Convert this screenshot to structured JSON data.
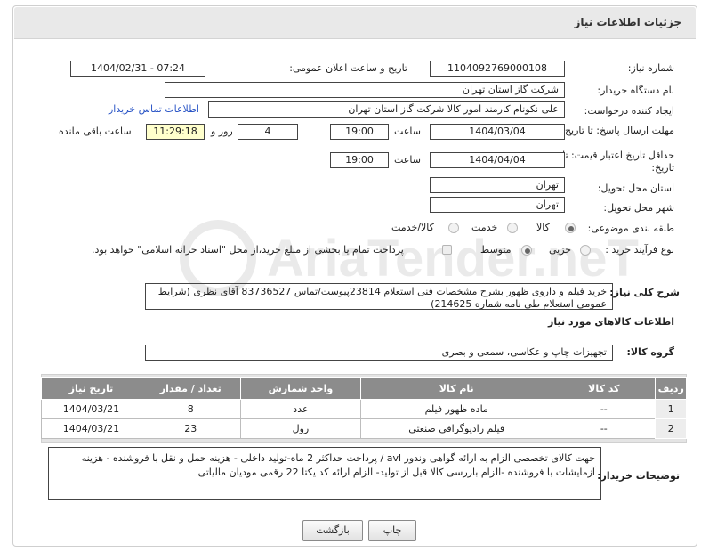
{
  "header": {
    "title": "جزئیات اطلاعات نیاز"
  },
  "fields": {
    "need_number_label": "شماره نیاز:",
    "need_number": "1104092769000108",
    "announce_label": "تاریخ و ساعت اعلان عمومی:",
    "announce_value": "1404/02/31 - 07:24",
    "buyer_org_label": "نام دستگاه خریدار:",
    "buyer_org": "شرکت گاز استان تهران",
    "creator_label": "ایجاد کننده درخواست:",
    "creator": "علی نکونام کارمند امور کالا شرکت گاز استان تهران",
    "contact_link": "اطلاعات تماس خریدار",
    "deadline_label": "مهلت ارسال پاسخ: تا تاریخ:",
    "deadline_date": "1404/03/04",
    "time_label": "ساعت",
    "deadline_time": "19:00",
    "days_value": "4",
    "days_label": "روز و",
    "remaining_time": "11:29:18",
    "remaining_label": "ساعت باقی مانده",
    "validity_label": "حداقل تاریخ اعتبار قیمت: تا تاریخ:",
    "validity_date": "1404/04/04",
    "validity_time": "19:00",
    "province_label": "استان محل تحویل:",
    "province": "تهران",
    "city_label": "شهر محل تحویل:",
    "city": "تهران",
    "category_label": "طبقه بندی موضوعی:",
    "category_options": [
      "کالا",
      "خدمت",
      "کالا/خدمت"
    ],
    "process_label": "نوع فرآیند خرید :",
    "process_options": [
      "جزیی",
      "متوسط"
    ],
    "payment_note": "پرداخت تمام یا بخشی از مبلغ خرید،از محل \"اسناد خزانه اسلامی\" خواهد بود.",
    "summary_label": "شرح کلی نیاز:",
    "summary": "خرید فیلم و داروی ظهور بشرح مشخصات فنی استعلام 23814پیوست/تماس 83736527 آقای نظری (شرایط عمومی استعلام طی نامه شماره 214625)",
    "goods_info_title": "اطلاعات کالاهای مورد نیاز",
    "goods_group_label": "گروه کالا:",
    "goods_group": "تجهیزات چاپ و عکاسی، سمعی و بصری",
    "buyer_notes_label": "توضیحات خریدار:",
    "buyer_notes": "جهت کالای تخصصی الزام به ارائه گواهی وندور avl  / پرداخت حداکثر 2 ماه-تولید داخلی - هزینه حمل و نقل با فروشنده - هزینه آزمایشات با فروشنده -الزام بازرسی کالا قبل از تولید- الزام ارائه کد یکتا 22 رقمی مودیان مالیاتی"
  },
  "table": {
    "headers": [
      "ردیف",
      "کد کالا",
      "نام کالا",
      "واحد شمارش",
      "تعداد / مقدار",
      "تاریخ نیاز"
    ],
    "rows": [
      [
        "1",
        "--",
        "ماده ظهور فیلم",
        "عدد",
        "8",
        "1404/03/21"
      ],
      [
        "2",
        "--",
        "فیلم رادیوگرافی صنعتی",
        "رول",
        "23",
        "1404/03/21"
      ]
    ]
  },
  "buttons": {
    "print": "چاپ",
    "back": "بازگشت"
  },
  "watermark": {
    "text": "AriaTender.neT"
  },
  "colors": {
    "header_bg": "#e9e9e9",
    "table_header": "#8c8c8c",
    "link": "#2a55c6"
  }
}
